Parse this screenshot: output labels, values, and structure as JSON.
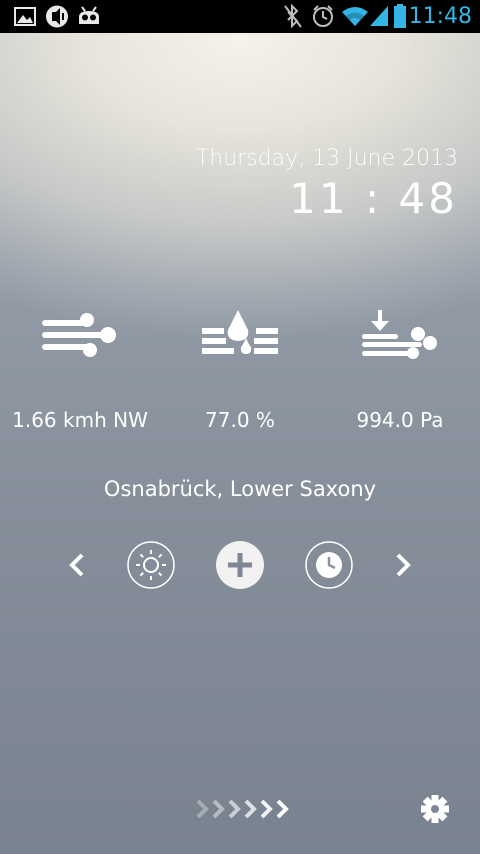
{
  "status_bar": {
    "time": "11:48",
    "left_icons": [
      "gallery-icon",
      "media-icon",
      "android-robot-icon"
    ],
    "right_icons": [
      "bluetooth-off-icon",
      "alarm-icon",
      "wifi-icon",
      "signal-icon",
      "battery-icon"
    ],
    "accent_color": "#33b5e5"
  },
  "header": {
    "date": "Thursday, 13 June 2013",
    "time": "11 : 48"
  },
  "metrics": [
    {
      "icon": "wind-icon",
      "value": "1.66 kmh NW"
    },
    {
      "icon": "humidity-icon",
      "value": "77.0 %"
    },
    {
      "icon": "pressure-icon",
      "value": "994.0 Pa"
    }
  ],
  "location": "Osnabrück, Lower Saxony",
  "controls": {
    "icons": [
      "chevron-left-icon",
      "sun-icon",
      "plus-icon",
      "clock-icon",
      "chevron-right-icon"
    ]
  },
  "bottom_bar": {
    "icons": [
      "arrows-icon",
      "gear-icon"
    ]
  }
}
